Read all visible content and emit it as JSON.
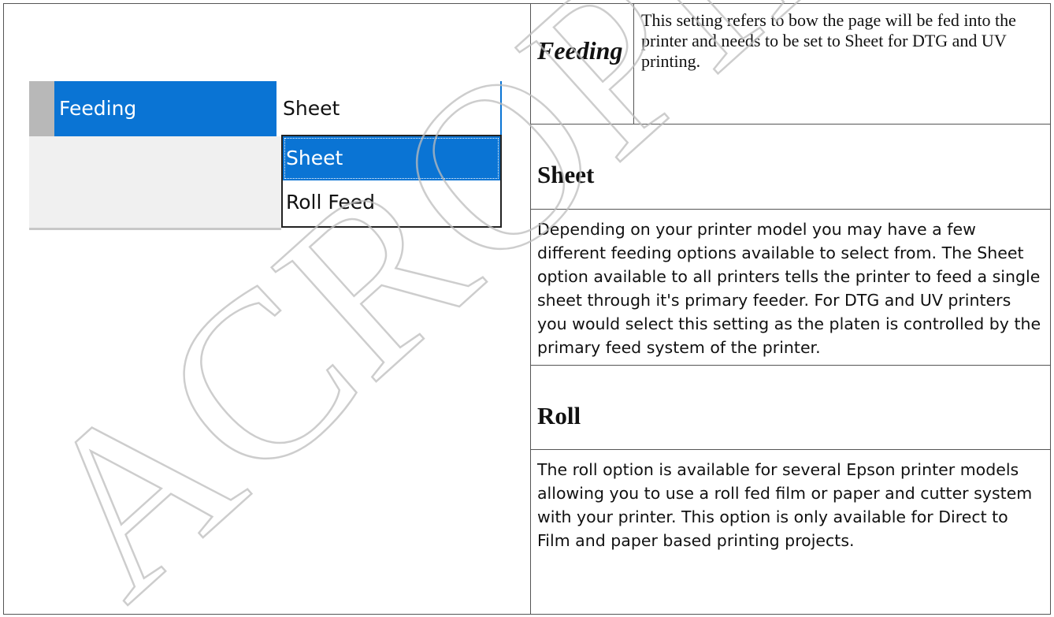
{
  "ui_crop": {
    "label": "Feeding",
    "value": "Sheet",
    "options": [
      "Sheet",
      "Roll Feed"
    ],
    "selected_option": "Sheet",
    "colors": {
      "accent": "#0a74d4",
      "panel": "#f0f0f0"
    }
  },
  "feeding": {
    "key": "Feeding",
    "description": "This setting refers to bow the page will be fed into the printer and needs to be set to Sheet for DTG and UV printing."
  },
  "sheet": {
    "heading": "Sheet",
    "body": "Depending on your printer model you may have a few different feeding options available to select from. The Sheet option available to all printers tells the printer to feed a single sheet through it's primary feeder. For DTG and UV printers you would select this setting as the platen is controlled by the primary feed system of the printer."
  },
  "roll": {
    "heading": "Roll",
    "body": "The roll option is available for several Epson printer models allowing you to use a roll fed film or paper and cutter system with your printer. This option is only available for Direct to Film and paper based printing projects."
  },
  "watermark": {
    "text": "ACROPIP"
  }
}
